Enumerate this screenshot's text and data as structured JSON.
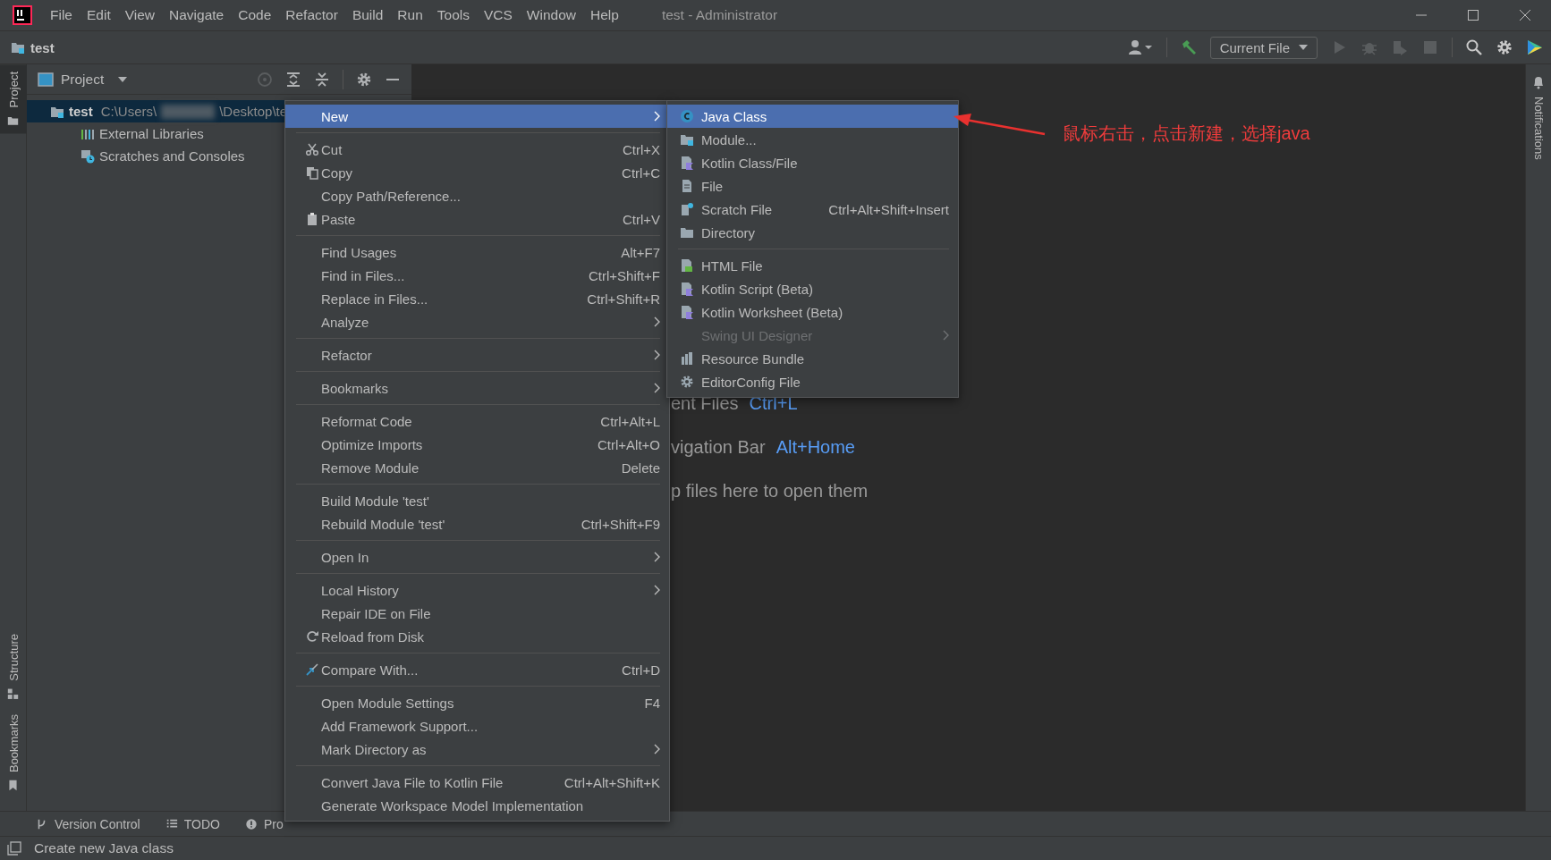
{
  "menu_bar": {
    "items": [
      "File",
      "Edit",
      "View",
      "Navigate",
      "Code",
      "Refactor",
      "Build",
      "Run",
      "Tools",
      "VCS",
      "Window",
      "Help"
    ],
    "title": "test - Administrator"
  },
  "navigation_bar": {
    "breadcrumb": "test",
    "run_configuration": "Current File"
  },
  "left_tool_strip": [
    {
      "label": "Project",
      "selected": true
    },
    {
      "label": "Structure",
      "selected": false
    },
    {
      "label": "Bookmarks",
      "selected": false
    }
  ],
  "project_panel": {
    "title": "Project",
    "tree": [
      {
        "kind": "module",
        "name": "test",
        "path_start": "C:\\Users\\",
        "path_end": "\\Desktop\\te",
        "selected": true
      },
      {
        "kind": "libraries",
        "name": "External Libraries",
        "selected": false
      },
      {
        "kind": "scratches",
        "name": "Scratches and Consoles",
        "selected": false
      }
    ]
  },
  "editor_hints": [
    {
      "text": "ent Files",
      "shortcut": "Ctrl+L"
    },
    {
      "text": "vigation Bar",
      "shortcut": "Alt+Home"
    },
    {
      "text": "p files here to open them"
    }
  ],
  "context_menu": {
    "items": [
      {
        "kind": "item",
        "label": "New",
        "submenu": true,
        "selected": true
      },
      {
        "kind": "separator"
      },
      {
        "kind": "item",
        "label": "Cut",
        "shortcut": "Ctrl+X",
        "submenu": false,
        "selected": false
      },
      {
        "kind": "item",
        "label": "Copy",
        "shortcut": "Ctrl+C",
        "submenu": false,
        "selected": false
      },
      {
        "kind": "item",
        "label": "Copy Path/Reference...",
        "submenu": false,
        "selected": false
      },
      {
        "kind": "item",
        "label": "Paste",
        "shortcut": "Ctrl+V",
        "submenu": false,
        "selected": false
      },
      {
        "kind": "separator"
      },
      {
        "kind": "item",
        "label": "Find Usages",
        "shortcut": "Alt+F7",
        "submenu": false,
        "selected": false
      },
      {
        "kind": "item",
        "label": "Find in Files...",
        "shortcut": "Ctrl+Shift+F",
        "submenu": false,
        "selected": false
      },
      {
        "kind": "item",
        "label": "Replace in Files...",
        "shortcut": "Ctrl+Shift+R",
        "submenu": false,
        "selected": false
      },
      {
        "kind": "item",
        "label": "Analyze",
        "submenu": true,
        "selected": false
      },
      {
        "kind": "separator"
      },
      {
        "kind": "item",
        "label": "Refactor",
        "submenu": true,
        "selected": false
      },
      {
        "kind": "separator"
      },
      {
        "kind": "item",
        "label": "Bookmarks",
        "submenu": true,
        "selected": false
      },
      {
        "kind": "separator"
      },
      {
        "kind": "item",
        "label": "Reformat Code",
        "shortcut": "Ctrl+Alt+L",
        "submenu": false,
        "selected": false
      },
      {
        "kind": "item",
        "label": "Optimize Imports",
        "shortcut": "Ctrl+Alt+O",
        "submenu": false,
        "selected": false
      },
      {
        "kind": "item",
        "label": "Remove Module",
        "shortcut": "Delete",
        "submenu": false,
        "selected": false
      },
      {
        "kind": "separator"
      },
      {
        "kind": "item",
        "label": "Build Module 'test'",
        "submenu": false,
        "selected": false
      },
      {
        "kind": "item",
        "label": "Rebuild Module 'test'",
        "shortcut": "Ctrl+Shift+F9",
        "submenu": false,
        "selected": false
      },
      {
        "kind": "separator"
      },
      {
        "kind": "item",
        "label": "Open In",
        "submenu": true,
        "selected": false
      },
      {
        "kind": "separator"
      },
      {
        "kind": "item",
        "label": "Local History",
        "submenu": true,
        "selected": false
      },
      {
        "kind": "item",
        "label": "Repair IDE on File",
        "submenu": false,
        "selected": false
      },
      {
        "kind": "item",
        "label": "Reload from Disk",
        "submenu": false,
        "selected": false
      },
      {
        "kind": "separator"
      },
      {
        "kind": "item",
        "label": "Compare With...",
        "shortcut": "Ctrl+D",
        "submenu": false,
        "selected": false
      },
      {
        "kind": "separator"
      },
      {
        "kind": "item",
        "label": "Open Module Settings",
        "shortcut": "F4",
        "submenu": false,
        "selected": false
      },
      {
        "kind": "item",
        "label": "Add Framework Support...",
        "submenu": false,
        "selected": false
      },
      {
        "kind": "item",
        "label": "Mark Directory as",
        "submenu": true,
        "selected": false
      },
      {
        "kind": "separator"
      },
      {
        "kind": "item",
        "label": "Convert Java File to Kotlin File",
        "shortcut": "Ctrl+Alt+Shift+K",
        "submenu": false,
        "selected": false
      },
      {
        "kind": "item",
        "label": "Generate Workspace Model Implementation",
        "submenu": false,
        "selected": false
      }
    ]
  },
  "new_submenu": {
    "items": [
      {
        "kind": "item",
        "label": "Java Class",
        "submenu": false,
        "selected": true,
        "disabled": false
      },
      {
        "kind": "item",
        "label": "Module...",
        "submenu": false,
        "selected": false,
        "disabled": false
      },
      {
        "kind": "item",
        "label": "Kotlin Class/File",
        "submenu": false,
        "selected": false,
        "disabled": false
      },
      {
        "kind": "item",
        "label": "File",
        "submenu": false,
        "selected": false,
        "disabled": false
      },
      {
        "kind": "item",
        "label": "Scratch File",
        "shortcut": "Ctrl+Alt+Shift+Insert",
        "submenu": false,
        "selected": false,
        "disabled": false
      },
      {
        "kind": "item",
        "label": "Directory",
        "submenu": false,
        "selected": false,
        "disabled": false
      },
      {
        "kind": "separator"
      },
      {
        "kind": "item",
        "label": "HTML File",
        "submenu": false,
        "selected": false,
        "disabled": false
      },
      {
        "kind": "item",
        "label": "Kotlin Script (Beta)",
        "submenu": false,
        "selected": false,
        "disabled": false
      },
      {
        "kind": "item",
        "label": "Kotlin Worksheet (Beta)",
        "submenu": false,
        "selected": false,
        "disabled": false
      },
      {
        "kind": "item",
        "label": "Swing UI Designer",
        "submenu": true,
        "selected": false,
        "disabled": true
      },
      {
        "kind": "item",
        "label": "Resource Bundle",
        "submenu": false,
        "selected": false,
        "disabled": false
      },
      {
        "kind": "item",
        "label": "EditorConfig File",
        "submenu": false,
        "selected": false,
        "disabled": false
      }
    ]
  },
  "annotation": {
    "text": "鼠标右击，点击新建，选择java"
  },
  "right_tool_strip": {
    "label": "Notifications"
  },
  "bottom_tool_bar": [
    {
      "label": "Version Control"
    },
    {
      "label": "TODO"
    },
    {
      "label": "Pro"
    }
  ],
  "status_bar": {
    "text": "Create new Java class"
  }
}
